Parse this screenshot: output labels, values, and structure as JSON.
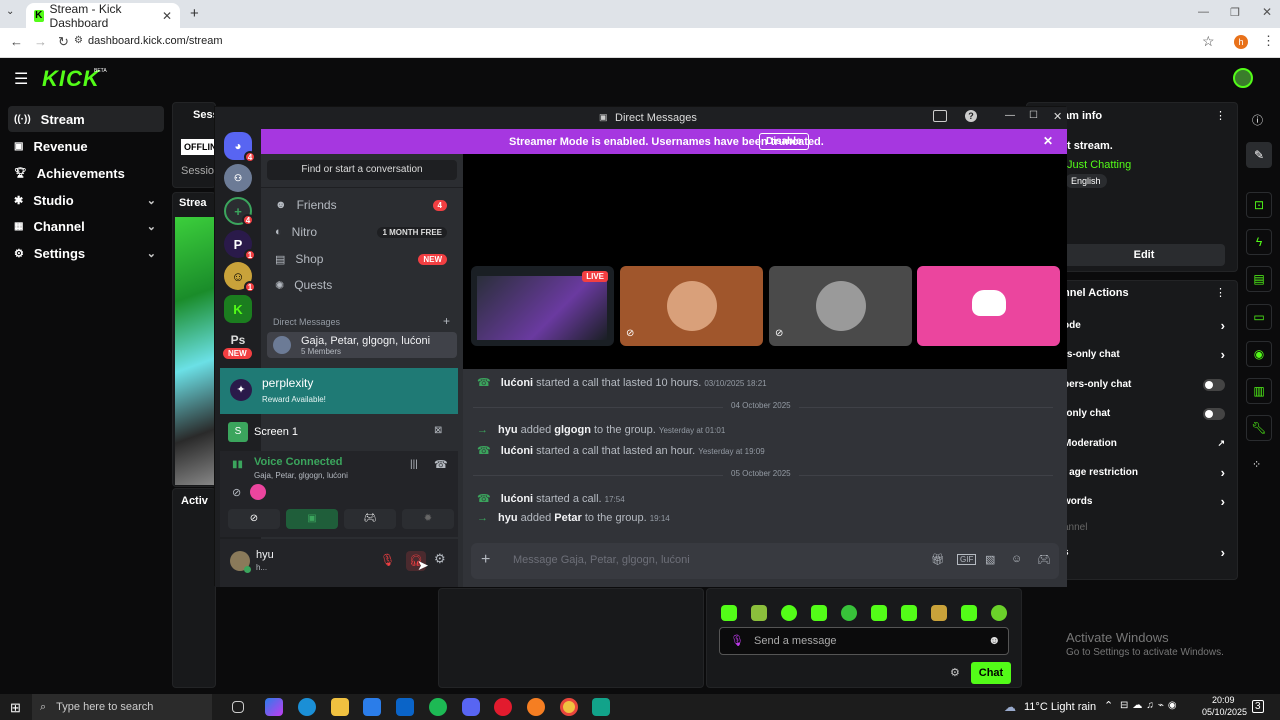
{
  "browser": {
    "tab_title": "Stream - Kick Dashboard",
    "url": "dashboard.kick.com/stream",
    "profile_initial": "h"
  },
  "kick": {
    "logo": "KICK",
    "logo_badge": "BETA",
    "nav": [
      {
        "label": "Stream",
        "icon": "broadcast-icon",
        "active": true
      },
      {
        "label": "Revenue",
        "icon": "wallet-icon"
      },
      {
        "label": "Achievements",
        "icon": "trophy-icon"
      },
      {
        "label": "Studio",
        "icon": "gear-icon",
        "expandable": true
      },
      {
        "label": "Channel",
        "icon": "channel-icon",
        "expandable": true
      },
      {
        "label": "Settings",
        "icon": "settings-icon",
        "expandable": true
      }
    ],
    "session_title": "Sess",
    "offline_badge": "OFFLIN",
    "session_label": "Sessio",
    "stream_tab": "Strea",
    "activity_tab": "Activ",
    "stream_info": {
      "header": "am info",
      "title": "t stream.",
      "category": "Just Chatting",
      "language": "English",
      "edit_label": "Edit"
    },
    "channel_actions": {
      "header": "nnel Actions",
      "items": [
        {
          "label": "ode",
          "control": "chevron"
        },
        {
          "label": "rs-only chat",
          "control": "chevron"
        },
        {
          "label": "bers-only chat",
          "control": "toggle"
        },
        {
          "label": "-only chat",
          "control": "toggle"
        },
        {
          "label": "Moderation",
          "control": "external"
        },
        {
          "label": "t age restriction",
          "control": "chevron"
        },
        {
          "label": "words",
          "control": "chevron"
        },
        {
          "label": "annel",
          "control": "none"
        },
        {
          "label": "s",
          "control": "chevron"
        }
      ]
    },
    "chat": {
      "placeholder": "Send a message",
      "send_label": "Chat"
    },
    "activate_windows": {
      "title": "Activate Windows",
      "subtitle": "Go to Settings to activate Windows."
    }
  },
  "discord": {
    "window_title": "Direct Messages",
    "banner_text": "Streamer Mode is enabled. Usernames have been truncated.",
    "banner_button": "Disable",
    "guild_badges": [
      "4",
      "4",
      "1",
      "1",
      "NEW"
    ],
    "guild_ps": "Ps",
    "search_label": "Find or start a conversation",
    "menu": [
      {
        "label": "Friends",
        "badge": "4",
        "icon": "friends-icon"
      },
      {
        "label": "Nitro",
        "badge": "1 MONTH FREE",
        "icon": "nitro-icon"
      },
      {
        "label": "Shop",
        "badge": "NEW",
        "icon": "shop-icon"
      },
      {
        "label": "Quests",
        "badge": "",
        "icon": "quests-icon"
      }
    ],
    "dm_header": "Direct Messages",
    "group_dm": {
      "name": "Gaja, Petar, glgogn, lućoni",
      "members": "5 Members"
    },
    "perplexity": {
      "title": "perplexity",
      "subtitle": "Reward Available!"
    },
    "screen_share": "Screen 1",
    "voice": {
      "status": "Voice Connected",
      "channel": "Gaja, Petar, glgogn, lućoni"
    },
    "user": {
      "name": "hyu",
      "status": "h..."
    },
    "live_label": "LIVE",
    "messages": [
      {
        "type": "call",
        "user": "lućoni",
        "text": "started a call that lasted 10 hours.",
        "time": "03/10/2025 18:21"
      },
      {
        "type": "divider",
        "text": "04 October 2025"
      },
      {
        "type": "add",
        "user": "hyu",
        "text": "added",
        "target": "glgogn",
        "suffix": "to the group.",
        "time": "Yesterday at 01:01"
      },
      {
        "type": "call",
        "user": "lućoni",
        "text": "started a call that lasted an hour.",
        "time": "Yesterday at 19:09"
      },
      {
        "type": "divider",
        "text": "05 October 2025"
      },
      {
        "type": "call",
        "user": "lućoni",
        "text": "started a call.",
        "time": "17:54"
      },
      {
        "type": "add",
        "user": "hyu",
        "text": "added",
        "target": "Petar",
        "suffix": "to the group.",
        "time": "19:14"
      }
    ],
    "composer_placeholder": "Message Gaja, Petar, glgogn, lućoni"
  },
  "taskbar": {
    "search_placeholder": "Type here to search",
    "weather": "11°C  Light rain",
    "time": "20:09",
    "date": "05/10/2025",
    "notif_count": "3"
  },
  "colors": {
    "kick_green": "#53fc18",
    "discord_blurple": "#5865f2",
    "streamer_purple": "#a637e0",
    "discord_pink": "#eb459e",
    "teal": "#1f7a75"
  }
}
